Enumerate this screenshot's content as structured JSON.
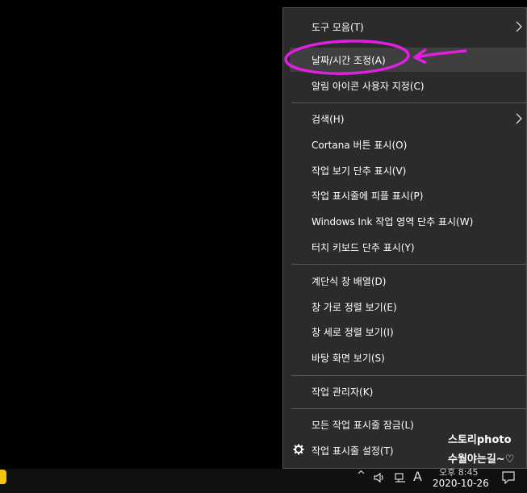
{
  "menu": {
    "items": [
      {
        "label": "도구 모음(T)"
      },
      {
        "label": "날짜/시간 조정(A)"
      },
      {
        "label": "알림 아이콘 사용자 지정(C)"
      },
      {
        "label": "검색(H)"
      },
      {
        "label": "Cortana 버튼 표시(O)"
      },
      {
        "label": "작업 보기 단추 표시(V)"
      },
      {
        "label": "작업 표시줄에 피플 표시(P)"
      },
      {
        "label": "Windows Ink 작업 영역 단추 표시(W)"
      },
      {
        "label": "터치 키보드 단추 표시(Y)"
      },
      {
        "label": "계단식 창 배열(D)"
      },
      {
        "label": "창 가로 정렬 보기(E)"
      },
      {
        "label": "창 세로 정렬 보기(I)"
      },
      {
        "label": "바탕 화면 보기(S)"
      },
      {
        "label": "작업 관리자(K)"
      },
      {
        "label": "모든 작업 표시줄 잠금(L)"
      },
      {
        "label": "작업 표시줄 설정(T)"
      }
    ],
    "highlight_color": "#3f3f3f",
    "background": "#2b2b2b"
  },
  "annotation": {
    "color": "#e020e0"
  },
  "taskbar": {
    "tray_chevron": "^",
    "ime": "A",
    "time": "오후 8:45",
    "date": "2020-10-26"
  },
  "watermark": {
    "line1": "스토리photo",
    "line2": "수월야는길~♡"
  }
}
